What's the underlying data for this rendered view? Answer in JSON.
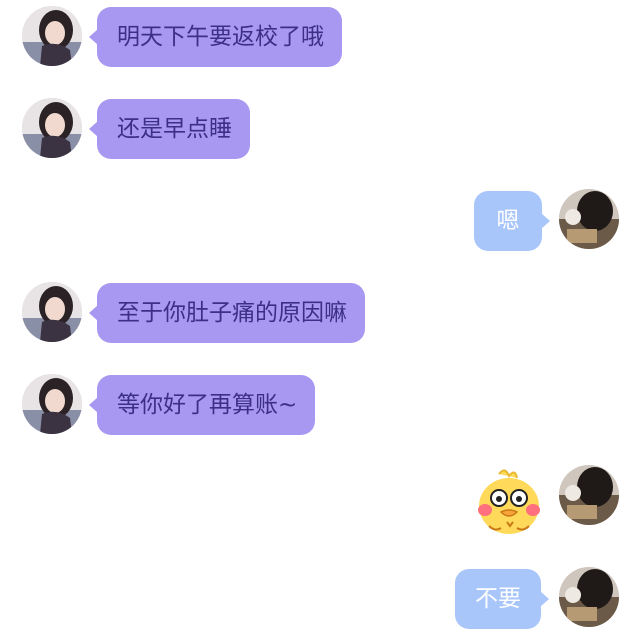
{
  "messages": [
    {
      "side": "left",
      "text": "明天下午要返校了哦"
    },
    {
      "side": "left",
      "text": "还是早点睡"
    },
    {
      "side": "right",
      "text": "嗯"
    },
    {
      "side": "left",
      "text": "至于你肚子痛的原因嘛"
    },
    {
      "side": "left",
      "text": "等你好了再算账~"
    },
    {
      "side": "right",
      "sticker": "crying-duck-sticker"
    },
    {
      "side": "right",
      "text": "不要"
    }
  ],
  "colors": {
    "left_bubble": "#a898f1",
    "left_text": "#3d2f86",
    "right_bubble": "#a9c6fb",
    "right_text": "#ffffff"
  }
}
